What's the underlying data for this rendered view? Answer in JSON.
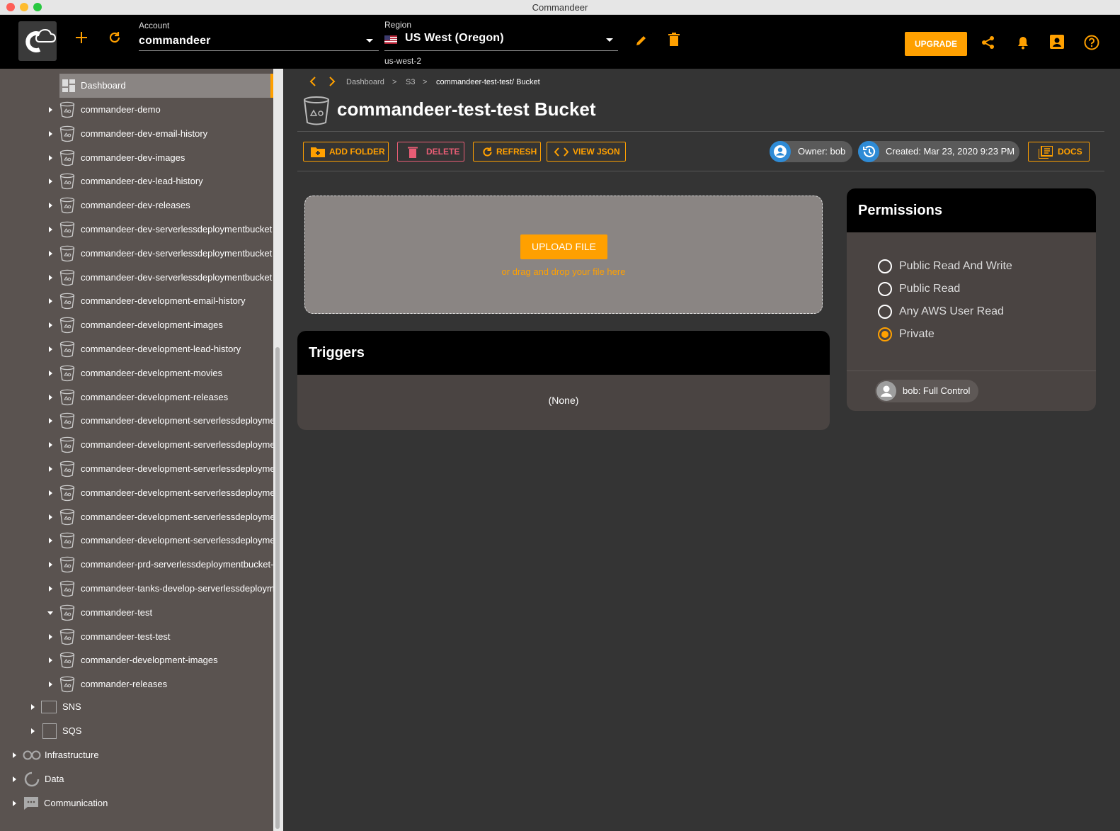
{
  "window": {
    "title": "Commandeer"
  },
  "header": {
    "account_label": "Account",
    "account_value": "commandeer",
    "region_label": "Region",
    "region_value": "US West (Oregon)",
    "region_code": "us-west-2",
    "upgrade_label": "UPGRADE"
  },
  "sidebar": {
    "dashboard_label": "Dashboard",
    "buckets": [
      "commandeer-demo",
      "commandeer-dev-email-history",
      "commandeer-dev-images",
      "commandeer-dev-lead-history",
      "commandeer-dev-releases",
      "commandeer-dev-serverlessdeploymentbucket",
      "commandeer-dev-serverlessdeploymentbucket",
      "commandeer-dev-serverlessdeploymentbucket",
      "commandeer-development-email-history",
      "commandeer-development-images",
      "commandeer-development-lead-history",
      "commandeer-development-movies",
      "commandeer-development-releases",
      "commandeer-development-serverlessdeployme",
      "commandeer-development-serverlessdeployme",
      "commandeer-development-serverlessdeployme",
      "commandeer-development-serverlessdeployme",
      "commandeer-development-serverlessdeployme",
      "commandeer-development-serverlessdeployme",
      "commandeer-prd-serverlessdeploymentbucket-",
      "commandeer-tanks-develop-serverlessdeploym",
      "commandeer-test",
      "commandeer-test-test",
      "commander-development-images",
      "commander-releases"
    ],
    "services": [
      "SNS",
      "SQS"
    ],
    "groups": [
      "Infrastructure",
      "Data",
      "Communication"
    ]
  },
  "breadcrumb": {
    "items": [
      "Dashboard",
      "S3",
      "commandeer-test-test/ Bucket"
    ],
    "separator": ">"
  },
  "page": {
    "title": "commandeer-test-test Bucket"
  },
  "toolbar": {
    "add_folder": "ADD FOLDER",
    "delete": "DELETE",
    "refresh": "REFRESH",
    "view_json": "VIEW JSON",
    "owner": "Owner: bob",
    "created": "Created: Mar 23, 2020 9:23 PM",
    "docs": "DOCS"
  },
  "upload": {
    "button": "UPLOAD FILE",
    "hint": "or drag and drop your file here"
  },
  "triggers": {
    "title": "Triggers",
    "empty": "(None)"
  },
  "permissions": {
    "title": "Permissions",
    "options": [
      "Public Read And Write",
      "Public Read",
      "Any AWS User Read",
      "Private"
    ],
    "selected": "Private",
    "grant": "bob: Full Control"
  },
  "colors": {
    "accent": "#ffa000",
    "danger": "#e85d75",
    "info": "#2e8bd6"
  }
}
